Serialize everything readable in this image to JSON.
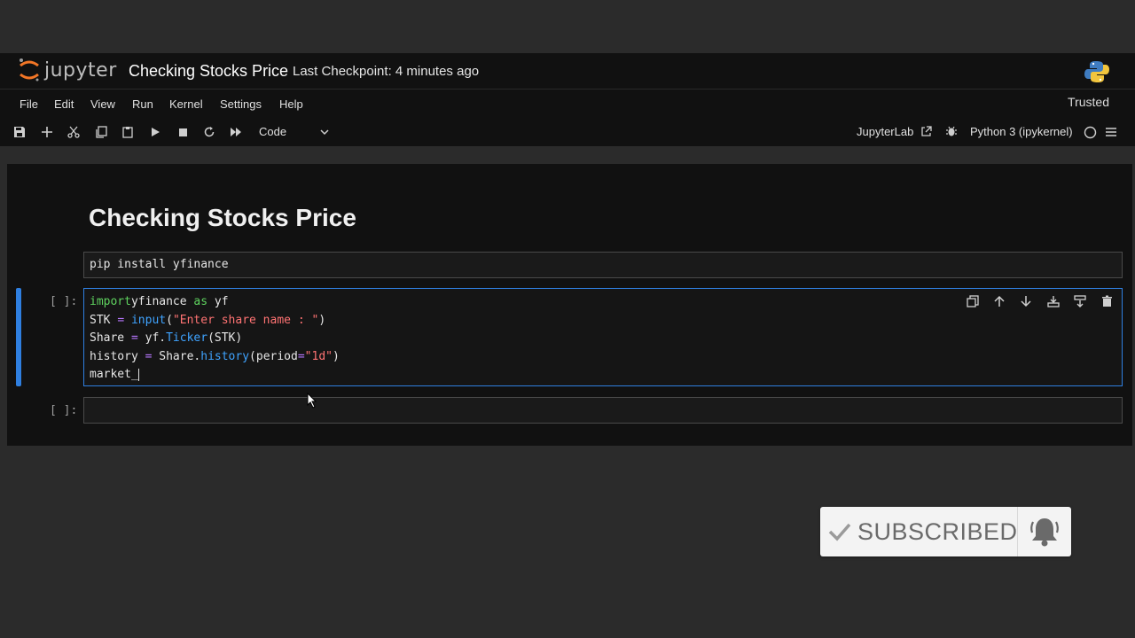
{
  "header": {
    "logo_text": "jupyter",
    "notebook_title": "Checking Stocks Price",
    "checkpoint": "Last Checkpoint: 4 minutes ago"
  },
  "menu": {
    "items": [
      "File",
      "Edit",
      "View",
      "Run",
      "Kernel",
      "Settings",
      "Help"
    ],
    "trusted": "Trusted"
  },
  "toolbar": {
    "cell_type": "Code",
    "jupyterlab_label": "JupyterLab",
    "kernel": "Python 3 (ipykernel)"
  },
  "notebook": {
    "heading": "Checking Stocks Price",
    "cell1": {
      "code": "pip install yfinance"
    },
    "cell2": {
      "prompt": "[ ]:",
      "lines": [
        [
          [
            "kw",
            "import"
          ],
          [
            "",
            "yfinance "
          ],
          [
            "kw",
            "as"
          ],
          [
            "",
            " yf"
          ]
        ],
        [
          [
            "",
            "STK "
          ],
          [
            "op",
            "="
          ],
          [
            "",
            ""
          ],
          [
            "fn",
            " input"
          ],
          [
            "",
            "("
          ],
          [
            "str",
            "\"Enter share name : \""
          ],
          [
            "",
            ")"
          ]
        ],
        [
          [
            "",
            "Share "
          ],
          [
            "op",
            "="
          ],
          [
            "",
            " yf."
          ],
          [
            "fn",
            "Ticker"
          ],
          [
            "",
            "(STK)"
          ]
        ],
        [
          [
            "",
            "history "
          ],
          [
            "op",
            "="
          ],
          [
            "",
            " Share."
          ],
          [
            "fn",
            "history"
          ],
          [
            "",
            "(period"
          ],
          [
            "op",
            "="
          ],
          [
            "str",
            "\"1d\""
          ],
          [
            "",
            ")"
          ]
        ],
        [
          [
            "",
            "market_"
          ]
        ]
      ]
    },
    "cell3": {
      "prompt": "[ ]:"
    }
  },
  "overlay": {
    "subscribed": "SUBSCRIBED"
  },
  "colors": {
    "accent": "#2f7fe0",
    "keyword": "#5fd35f",
    "function": "#3fa3ff",
    "string": "#ff7373",
    "operator": "#b877ff"
  }
}
